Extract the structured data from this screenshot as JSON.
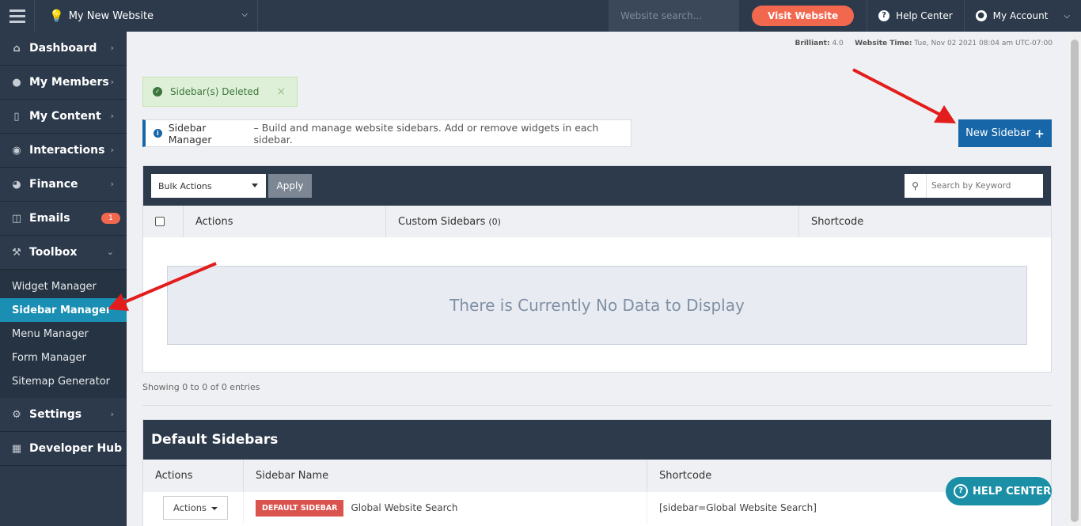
{
  "topbar": {
    "site_name": "My New Website",
    "search_placeholder": "Website search...",
    "visit_label": "Visit Website",
    "help_label": "Help Center",
    "account_label": "My Account"
  },
  "sidebar": {
    "items": [
      {
        "label": "Dashboard",
        "icon": "home-icon"
      },
      {
        "label": "My Members",
        "icon": "users-icon"
      },
      {
        "label": "My Content",
        "icon": "folder-icon"
      },
      {
        "label": "Interactions",
        "icon": "comments-icon"
      },
      {
        "label": "Finance",
        "icon": "pie-chart-icon"
      },
      {
        "label": "Emails",
        "icon": "inbox-icon",
        "badge": "1"
      },
      {
        "label": "Toolbox",
        "icon": "wrench-icon"
      }
    ],
    "toolbox_sub": [
      "Widget Manager",
      "Sidebar Manager",
      "Menu Manager",
      "Form Manager",
      "Sitemap Generator"
    ],
    "bottom_items": [
      {
        "label": "Settings",
        "icon": "gear-icon"
      },
      {
        "label": "Developer Hub",
        "icon": "grid-icon"
      }
    ]
  },
  "meta": {
    "version_label": "Brilliant:",
    "version": "4.0",
    "time_label": "Website Time:",
    "time": "Tue, Nov 02 2021 08:04 am UTC-07:00"
  },
  "alert": {
    "text": "Sidebar(s) Deleted",
    "close": "×"
  },
  "info": {
    "title": "Sidebar Manager",
    "text": "– Build and manage website sidebars. Add or remove widgets in each sidebar."
  },
  "new_button": {
    "label": "New Sidebar",
    "plus": "+"
  },
  "table": {
    "bulk_label": "Bulk Actions",
    "apply_label": "Apply",
    "search_placeholder": "Search by Keyword",
    "col_actions": "Actions",
    "col_custom": "Custom Sidebars",
    "col_custom_count": "(0)",
    "col_shortcode": "Shortcode",
    "empty_text": "There is Currently No Data to Display",
    "showing": "Showing 0 to 0 of 0 entries"
  },
  "defaults": {
    "title": "Default Sidebars",
    "col_actions": "Actions",
    "col_name": "Sidebar Name",
    "col_shortcode": "Shortcode",
    "row": {
      "actions_label": "Actions",
      "badge": "DEFAULT SIDEBAR",
      "name": "Global Website Search",
      "shortcode": "[sidebar=Global Website Search]"
    }
  },
  "help_pill": {
    "label": "HELP CENTER",
    "icon": "?"
  },
  "colors": {
    "navy": "#2c3a4b",
    "blue": "#1666a8",
    "orange": "#f2684f",
    "teal": "#1a8fb3",
    "red": "#e31c1c"
  }
}
